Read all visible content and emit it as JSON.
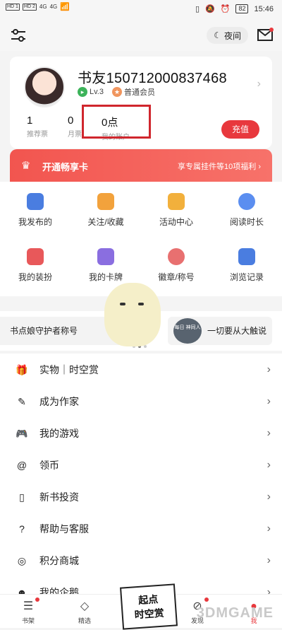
{
  "status": {
    "sig1": "HD 1",
    "sig2": "HD 2",
    "net1": "4G",
    "net2": "4G",
    "battery": "82",
    "time": "15:46"
  },
  "topbar": {
    "night_label": "夜间"
  },
  "profile": {
    "username": "书友150712000837468",
    "level": "Lv.3",
    "membership": "普通会员",
    "stats": [
      {
        "num": "1",
        "label": "推荐票"
      },
      {
        "num": "0",
        "label": "月票"
      },
      {
        "num": "0点",
        "label": "我的账户"
      }
    ],
    "recharge_label": "充值"
  },
  "vip": {
    "title": "开通畅享卡",
    "subtitle": "享专属挂件等10项福利 ›"
  },
  "grid": [
    {
      "label": "我发布的",
      "color": "#4a7de0"
    },
    {
      "label": "关注/收藏",
      "color": "#f2a23c"
    },
    {
      "label": "活动中心",
      "color": "#f2b03c"
    },
    {
      "label": "阅读时长",
      "color": "#5b8ef0"
    },
    {
      "label": "我的装扮",
      "color": "#e8585a"
    },
    {
      "label": "我的卡牌",
      "color": "#8a6ee0"
    },
    {
      "label": "徽章/称号",
      "color": "#e87070"
    },
    {
      "label": "浏览记录",
      "color": "#4a7de0"
    }
  ],
  "banner": {
    "left_text": "书点娘守护者称号",
    "right_text": "一切要从大触说",
    "tag_text": "每日 神同人"
  },
  "menu": [
    {
      "icon": "gift-icon",
      "glyph": "🎁",
      "label": "实物｜时空赏"
    },
    {
      "icon": "pen-icon",
      "glyph": "✎",
      "label": "成为作家"
    },
    {
      "icon": "gamepad-icon",
      "glyph": "🎮",
      "label": "我的游戏"
    },
    {
      "icon": "at-icon",
      "glyph": "@",
      "label": "领币"
    },
    {
      "icon": "book-icon",
      "glyph": "▯",
      "label": "新书投资"
    },
    {
      "icon": "question-icon",
      "glyph": "?",
      "label": "帮助与客服"
    },
    {
      "icon": "coins-icon",
      "glyph": "◎",
      "label": "积分商城"
    },
    {
      "icon": "penguin-icon",
      "glyph": "☻",
      "label": "我的企鹅"
    }
  ],
  "tabbar": [
    {
      "label": "书架",
      "glyph": "☰"
    },
    {
      "label": "精选",
      "glyph": "◇"
    },
    {
      "label": "",
      "glyph": ""
    },
    {
      "label": "发现",
      "glyph": "⊘"
    },
    {
      "label": "我",
      "glyph": "●"
    }
  ],
  "promo": {
    "line1": "起点",
    "line2": "时空赏"
  },
  "watermark": "3DMGAME"
}
